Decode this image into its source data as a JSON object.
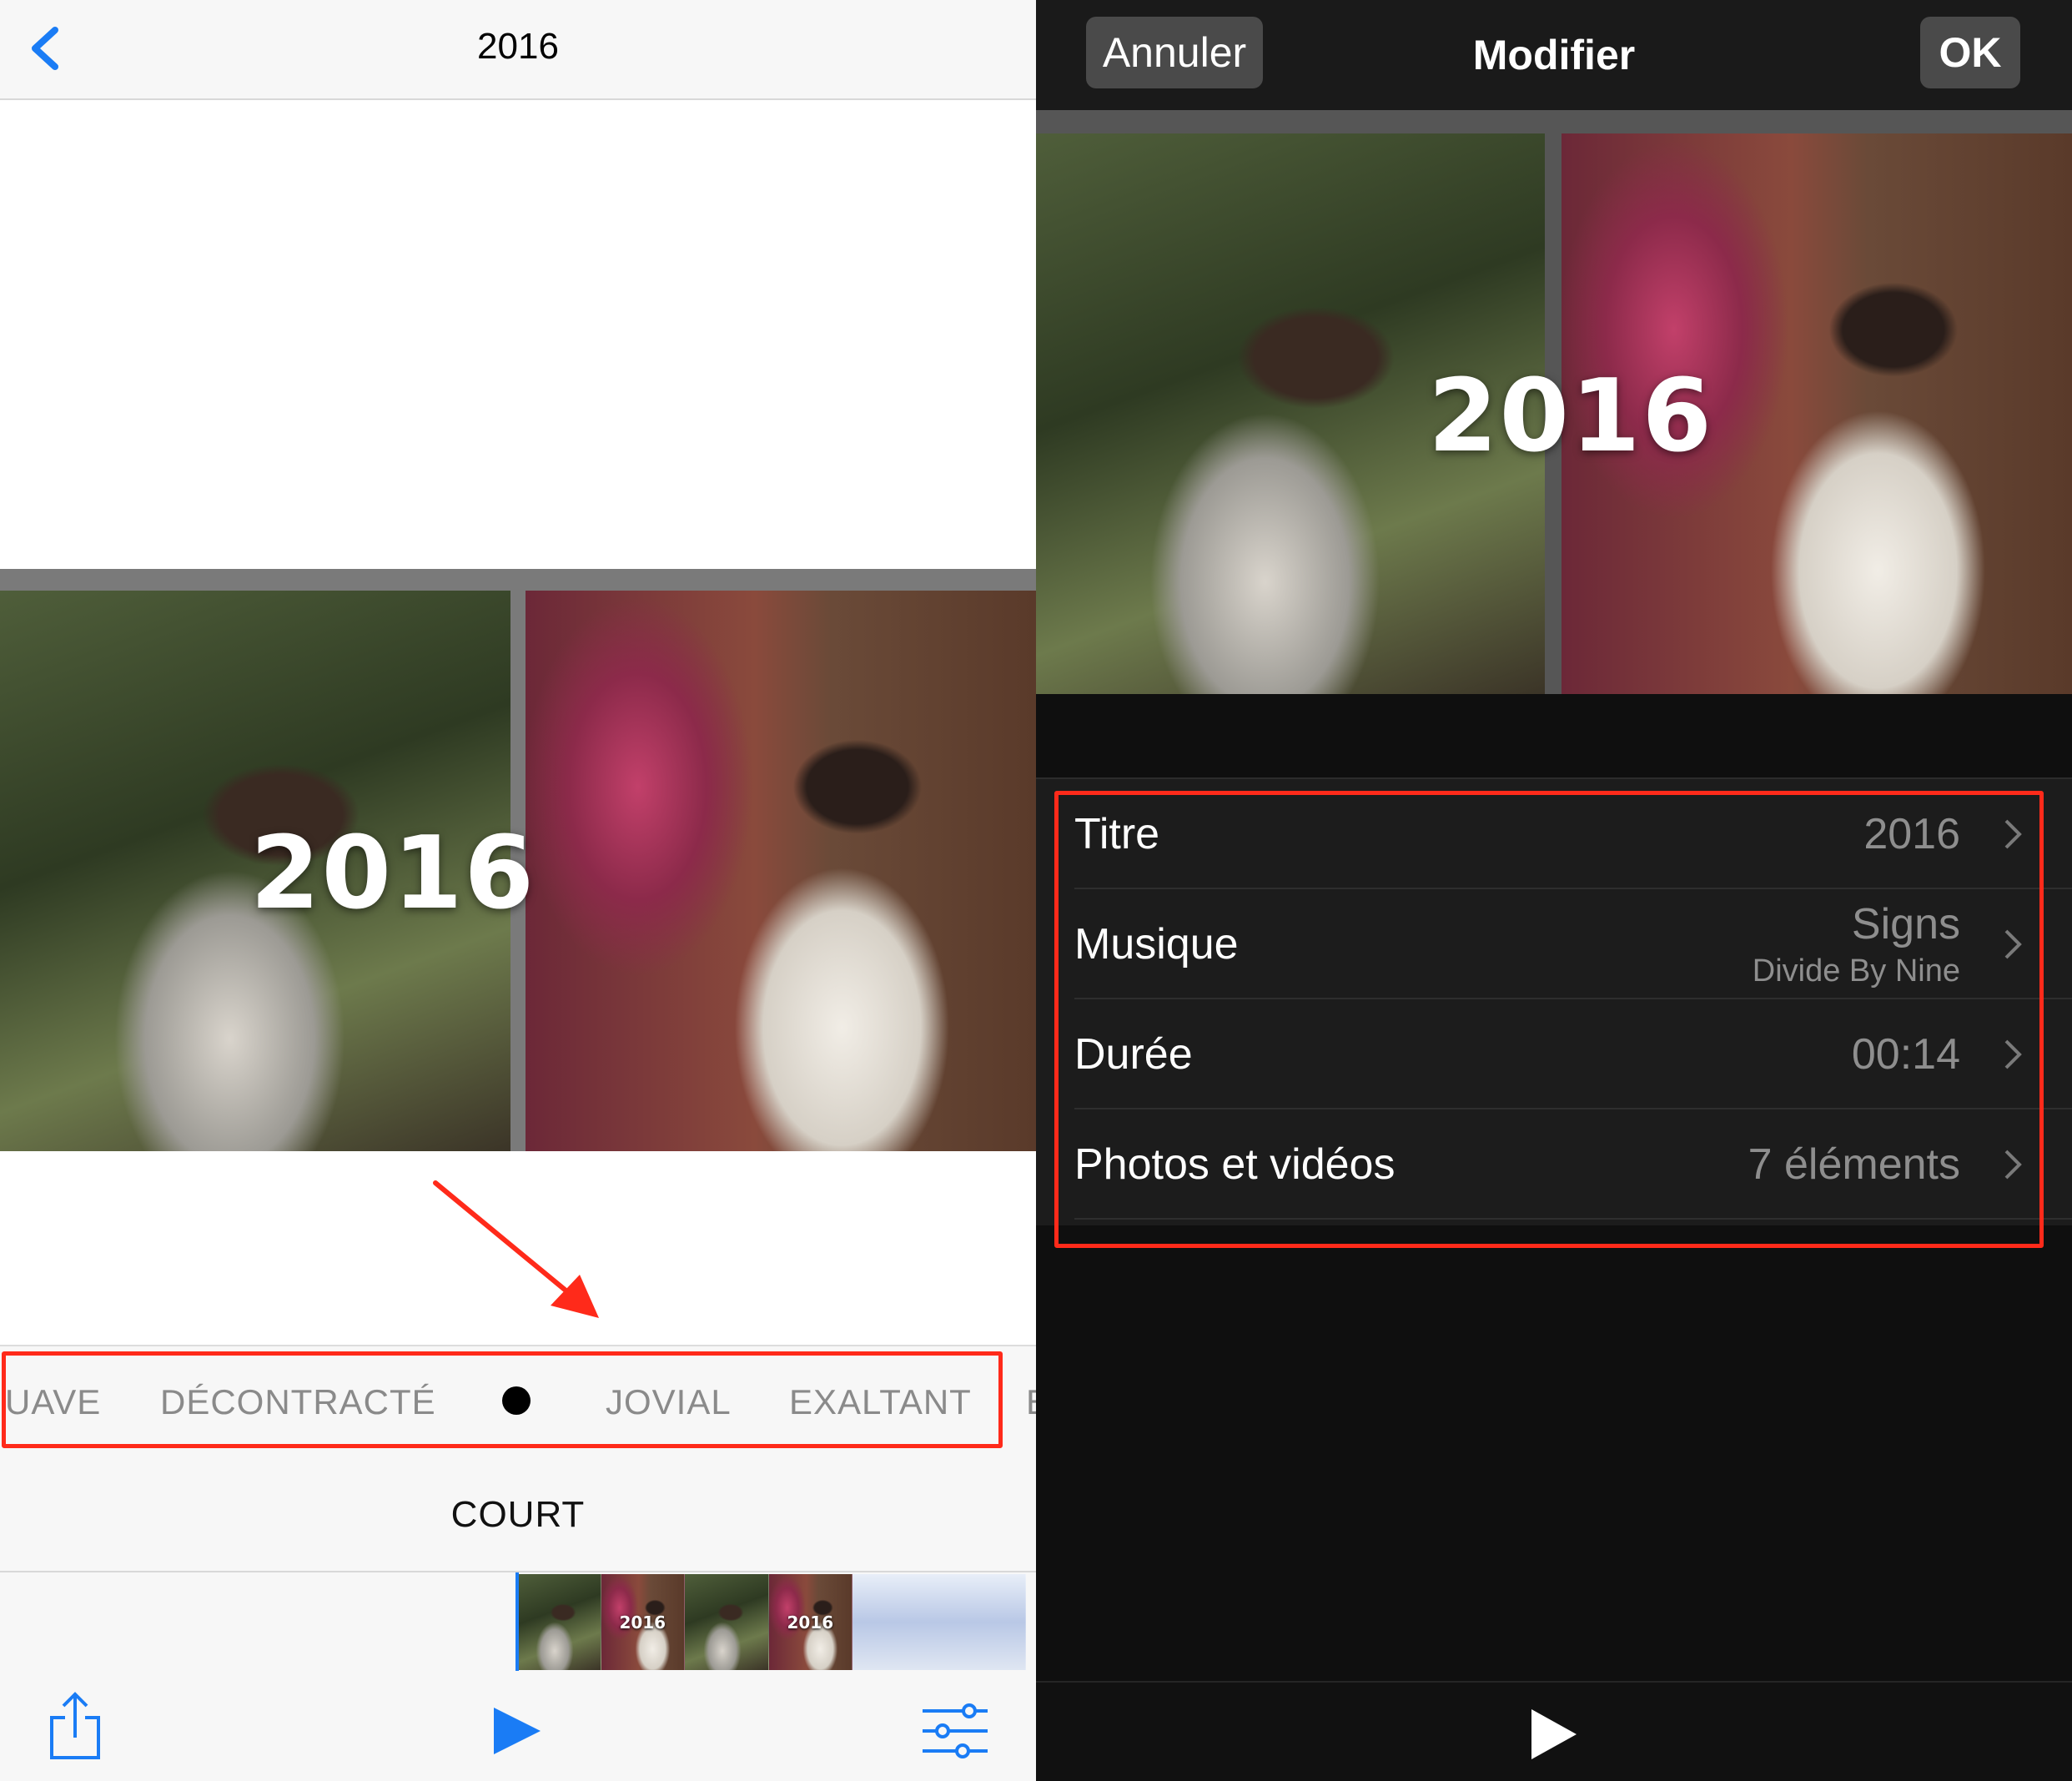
{
  "left": {
    "nav": {
      "title": "2016",
      "back_icon": "chevron-left-icon"
    },
    "preview": {
      "title_overlay": "2016"
    },
    "moods": [
      "UAVE",
      "DÉCONTRACTÉ",
      "JOVIAL",
      "EXALTANT",
      "E"
    ],
    "length_label": "COURT",
    "filmstrip": {
      "thumb_titles": [
        "2016",
        "2016"
      ]
    },
    "toolbar": {
      "share_icon": "share-icon",
      "play_icon": "play-icon",
      "settings_icon": "sliders-icon"
    },
    "colors": {
      "accent": "#1a7cf5",
      "highlight": "#ff2a1a"
    }
  },
  "right": {
    "nav": {
      "cancel_label": "Annuler",
      "title": "Modifier",
      "ok_label": "OK"
    },
    "preview": {
      "title_overlay": "2016"
    },
    "settings": [
      {
        "label": "Titre",
        "value": "2016"
      },
      {
        "label": "Musique",
        "value": "Signs",
        "subvalue": "Divide By Nine"
      },
      {
        "label": "Durée",
        "value": "00:14"
      },
      {
        "label": "Photos et vidéos",
        "value": "7 éléments"
      }
    ],
    "toolbar": {
      "play_icon": "play-icon"
    }
  }
}
